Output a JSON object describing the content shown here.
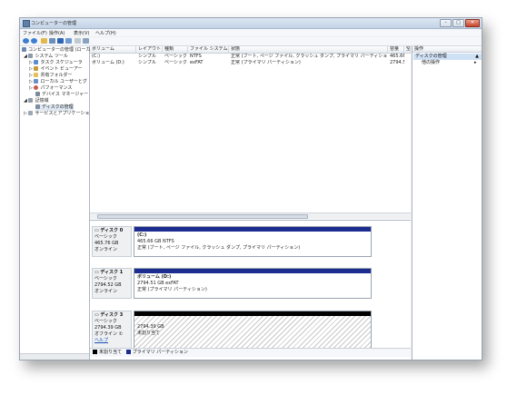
{
  "window": {
    "title": "コンピューターの管理"
  },
  "menu": [
    "ファイル(F)",
    "操作(A)",
    "表示(V)",
    "ヘルプ(H)"
  ],
  "toolbar_icons": [
    "back-icon",
    "forward-icon",
    "up-icon",
    "console-tree-icon",
    "properties-icon",
    "help-icon",
    "export-icon",
    "view-icon"
  ],
  "tree": [
    {
      "label": "コンピューターの管理 (ローカル)",
      "icon": "computer-icon"
    },
    {
      "label": "システム ツール",
      "icon": "tools-icon"
    },
    {
      "label": "タスク スケジューラ",
      "icon": "clock-icon"
    },
    {
      "label": "イベント ビューアー",
      "icon": "event-icon"
    },
    {
      "label": "共有フォルダー",
      "icon": "folder-icon"
    },
    {
      "label": "ローカル ユーザーとグ",
      "icon": "users-icon"
    },
    {
      "label": "パフォーマンス",
      "icon": "performance-icon"
    },
    {
      "label": "デバイス マネージャー",
      "icon": "device-icon"
    },
    {
      "label": "記憶域",
      "icon": "storage-icon"
    },
    {
      "label": "ディスクの管理",
      "icon": "disk-icon"
    },
    {
      "label": "サービスとアプリケーショ",
      "icon": "services-icon"
    }
  ],
  "grid": {
    "headers": [
      "ボリューム",
      "レイアウト",
      "種類",
      "ファイル システム",
      "状態",
      "容量",
      "空"
    ],
    "rows": [
      [
        "(C:)",
        "シンプル",
        "ベーシック",
        "NTFS",
        "正常 (ブート, ページ ファイル, クラッシュ ダンプ, プライマリ パーティション)",
        "465.66 G",
        ""
      ],
      [
        "ボリューム (D:)",
        "シンプル",
        "ベーシック",
        "exFAT",
        "正常 (プライマリ パーティション)",
        "2794.50",
        ""
      ]
    ]
  },
  "disks": [
    {
      "name": "ディスク 0",
      "type": "ベーシック",
      "size": "465.76 GB",
      "status": "オンライン",
      "volume": {
        "title": "(C:)",
        "size": "465.66 GB NTFS",
        "status": "正常 (ブート, ページ ファイル, クラッシュ ダンプ, プライマリ パーティション)"
      }
    },
    {
      "name": "ディスク 1",
      "type": "ベーシック",
      "size": "2794.52 GB",
      "status": "オンライン",
      "volume": {
        "title": "ボリューム (D:)",
        "size": "2794.51 GB exFAT",
        "status": "正常 (プライマリ パーティション)"
      }
    },
    {
      "name": "ディスク 3",
      "type": "ベーシック",
      "size": "2794.39 GB",
      "status": "オフライン ①",
      "help": "ヘルプ",
      "volume": {
        "size": "2794.39 GB",
        "status": "未割り当て"
      }
    }
  ],
  "legend": {
    "unallocated": "未割り当て",
    "primary": "プライマリ パーティション",
    "unallocated_color": "#000000",
    "primary_color": "#1c2d8f"
  },
  "actions": {
    "header": "操作",
    "selected": "ディスクの管理",
    "other": "他の操作"
  }
}
